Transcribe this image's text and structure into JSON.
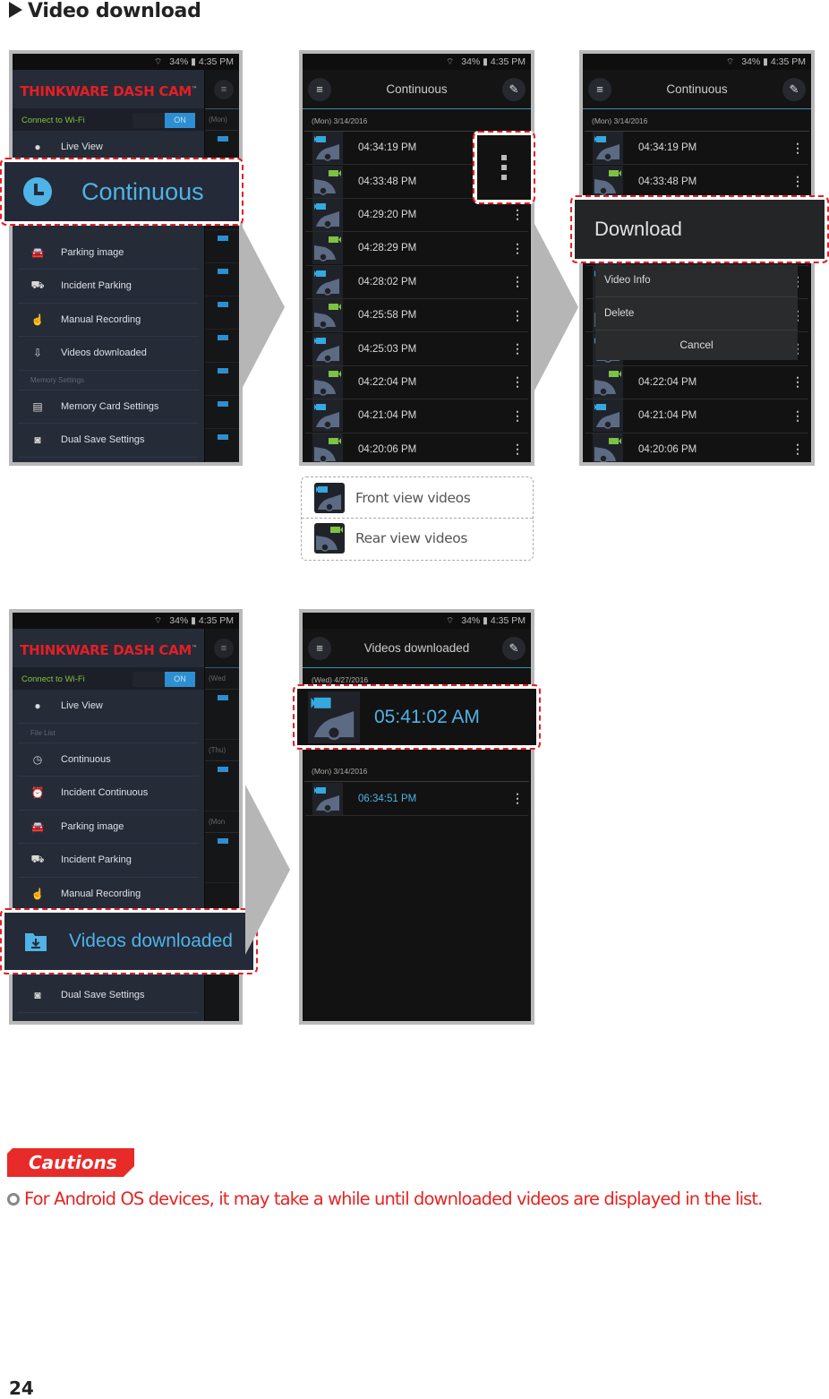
{
  "heading": "Video download",
  "status_bar": {
    "battery": "34%",
    "time": "4:35 PM"
  },
  "drawer": {
    "brand": "THINKWARE DASH CAM",
    "trademark": "™",
    "wifi_label": "Connect to Wi-Fi",
    "wifi_toggle": "ON",
    "live_view": "Live View",
    "file_list_section": "File List",
    "items": [
      {
        "label": "Continuous",
        "icon": "clock-icon"
      },
      {
        "label": "Incident Continuous",
        "icon": "alarm-clock-icon"
      },
      {
        "label": "Parking image",
        "icon": "parked-car-icon"
      },
      {
        "label": "Incident Parking",
        "icon": "incident-car-icon"
      },
      {
        "label": "Manual Recording",
        "icon": "hand-pointer-icon"
      },
      {
        "label": "Videos downloaded",
        "icon": "download-folder-icon"
      }
    ],
    "memory_section": "Memory Settings",
    "memory_items": [
      {
        "label": "Memory Card Settings",
        "icon": "sd-card-icon"
      },
      {
        "label": "Dual Save Settings",
        "icon": "dual-save-icon"
      }
    ],
    "peek_dates_1": [
      "(Mon)"
    ],
    "peek_dates_2": [
      "(Wed",
      "(Thu)",
      "(Mon"
    ]
  },
  "screen1_callout": "Continuous",
  "continuous_screen": {
    "title": "Continuous",
    "date": "(Mon) 3/14/2016",
    "rows": [
      {
        "time": "04:34:19 PM",
        "view": "front"
      },
      {
        "time": "04:33:48 PM",
        "view": "rear"
      },
      {
        "time": "04:29:20 PM",
        "view": "front"
      },
      {
        "time": "04:28:29 PM",
        "view": "rear"
      },
      {
        "time": "04:28:02 PM",
        "view": "front"
      },
      {
        "time": "04:25:58 PM",
        "view": "rear"
      },
      {
        "time": "04:25:03 PM",
        "view": "front"
      },
      {
        "time": "04:22:04 PM",
        "view": "rear"
      },
      {
        "time": "04:21:04 PM",
        "view": "front"
      },
      {
        "time": "04:20:06 PM",
        "view": "rear"
      }
    ]
  },
  "context_menu": {
    "download": "Download",
    "video_info": "Video Info",
    "delete": "Delete",
    "cancel": "Cancel"
  },
  "legend": {
    "front": "Front view videos",
    "rear": "Rear view videos"
  },
  "screen4_callout": "Videos downloaded",
  "downloaded_screen": {
    "title": "Videos downloaded",
    "groups": [
      {
        "date": "(Wed) 4/27/2016",
        "rows": [
          {
            "time": "05:41:02 AM",
            "view": "front"
          }
        ]
      },
      {
        "date": "(Mon) 3/14/2016",
        "rows": [
          {
            "time": "06:34:51 PM",
            "view": "front"
          }
        ]
      }
    ]
  },
  "cautions": {
    "tag": "Cautions",
    "text": "For Android OS devices, it may take a while until downloaded videos are displayed in the list."
  },
  "page_number": "24",
  "colors": {
    "accent_red": "#e51e25",
    "front_cam": "#35a8e0",
    "rear_cam": "#7dc242",
    "highlight_text": "#4fb3e6"
  }
}
